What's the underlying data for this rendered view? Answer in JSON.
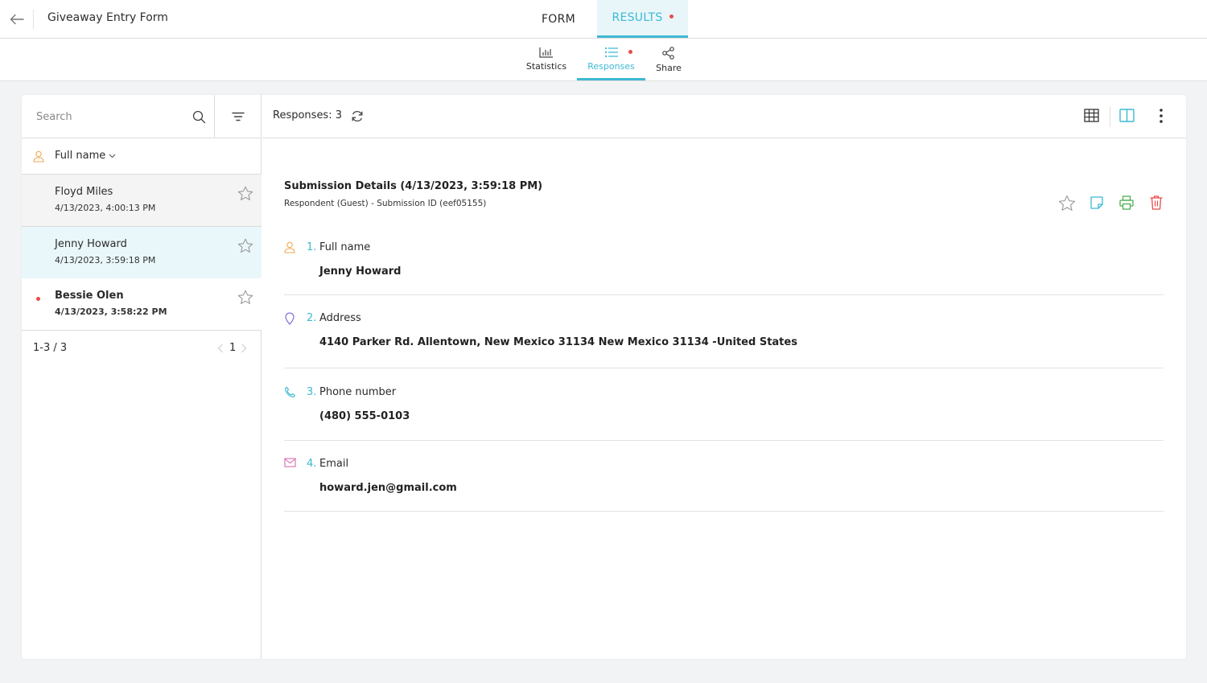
{
  "header": {
    "form_title": "Giveaway Entry Form",
    "tab_form": "FORM",
    "tab_results": "RESULTS"
  },
  "subnav": {
    "statistics": "Statistics",
    "responses": "Responses",
    "share": "Share"
  },
  "list": {
    "search_placeholder": "Search",
    "column_header": "Full name",
    "rows": [
      {
        "name": "Floyd Miles",
        "date": "4/13/2023, 4:00:13 PM",
        "unread": false,
        "selected": false
      },
      {
        "name": "Jenny Howard",
        "date": "4/13/2023, 3:59:18 PM",
        "unread": false,
        "selected": true
      },
      {
        "name": "Bessie Olen",
        "date": "4/13/2023, 3:58:22 PM",
        "unread": true,
        "selected": false
      }
    ],
    "range": "1-3 / 3",
    "page": "1"
  },
  "detail": {
    "responses_count": "Responses: 3",
    "title": "Submission Details (4/13/2023, 3:59:18 PM)",
    "meta": "Respondent (Guest) - Submission ID (eef05155)",
    "fields": [
      {
        "number": "1.",
        "label": "Full name",
        "value": "Jenny Howard",
        "icon": "person-icon",
        "color": "#f0a955"
      },
      {
        "number": "2.",
        "label": "Address",
        "value": "4140 Parker Rd. Allentown, New Mexico 31134 New Mexico 31134 -United States",
        "icon": "location-pin-icon",
        "color": "#7a5cd6"
      },
      {
        "number": "3.",
        "label": "Phone number",
        "value": "(480) 555-0103",
        "icon": "phone-icon",
        "color": "#3db9d3"
      },
      {
        "number": "4.",
        "label": "Email",
        "value": "howard.jen@gmail.com",
        "icon": "mail-icon",
        "color": "#d66bb0"
      }
    ]
  },
  "colors": {
    "accent": "#3db9d3",
    "notification_dot": "#e84b4b",
    "selected_row_bg": "#e9f7fb",
    "print_green": "#4caf50",
    "delete_red": "#e84b4b"
  }
}
